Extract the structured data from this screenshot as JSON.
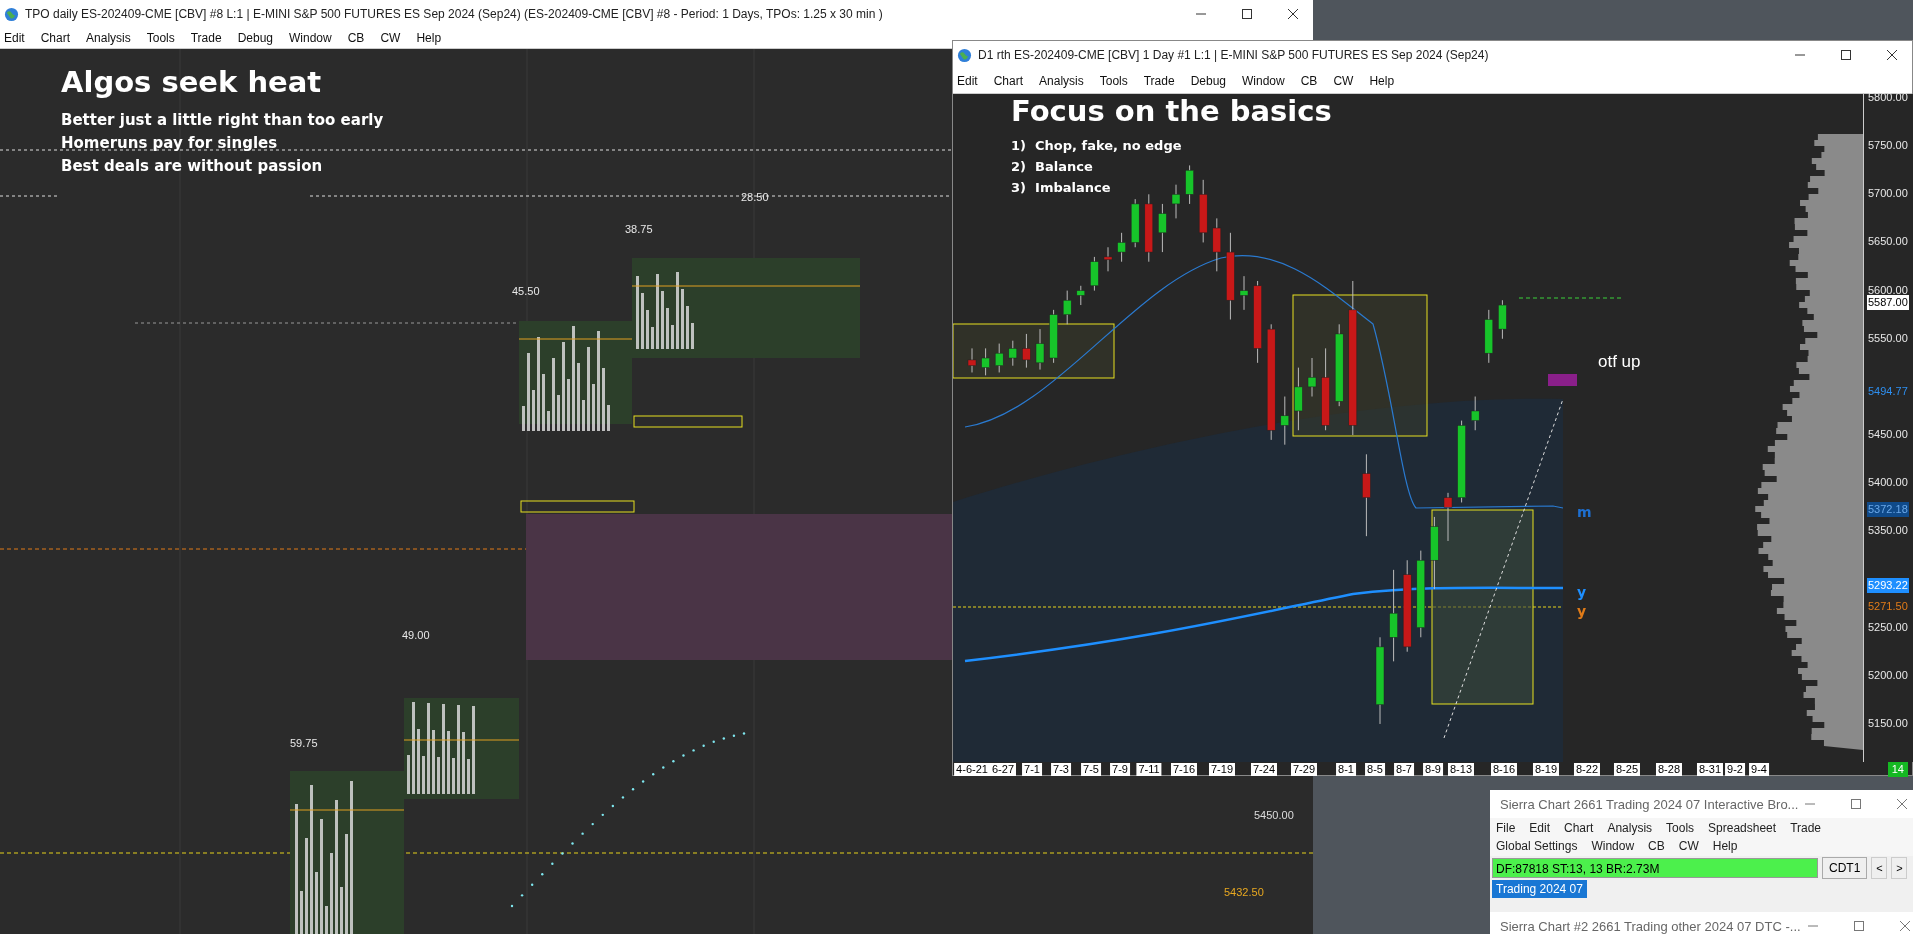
{
  "tpo_window": {
    "title": "TPO daily ES-202409-CME [CBV] #8 L:1 | E-MINI S&P 500 FUTURES ES Sep 2024 (Sep24) (ES-202409-CME [CBV] #8 - Period: 1 Days, TPOs: 1.25 x 30 min  )",
    "menu": [
      "Edit",
      "Chart",
      "Analysis",
      "Tools",
      "Trade",
      "Debug",
      "Window",
      "CB",
      "CW",
      "Help"
    ],
    "headline": "Algos seek heat",
    "notes": [
      "Better just a little right than too early",
      "Homeruns pay for singles",
      "Best deals are without passion"
    ],
    "profile_labels": [
      "59.75",
      "49.00",
      "45.50",
      "38.75",
      "28.50"
    ],
    "price_labels": [
      {
        "text": "5450.00",
        "kind": "tick"
      },
      {
        "text": "5432.50",
        "kind": "level"
      }
    ]
  },
  "chart_window": {
    "title": "D1 rth ES-202409-CME [CBV]  1 Day  #1 L:1 | E-MINI S&P 500 FUTURES ES Sep 2024 (Sep24)",
    "menu": [
      "Edit",
      "Chart",
      "Analysis",
      "Tools",
      "Trade",
      "Debug",
      "Window",
      "CB",
      "CW",
      "Help"
    ],
    "headline": "Focus on the basics",
    "points": [
      "1)  Chop, fake, no edge",
      "2)  Balance",
      "3)  Imbalance"
    ],
    "annotation": "otf up",
    "line_markers": [
      {
        "text": "m",
        "color": "#1e6fd0"
      },
      {
        "text": "y",
        "color": "#1e8fff"
      },
      {
        "text": "y",
        "color": "#e07b18"
      }
    ],
    "price_axis": [
      {
        "text": "5800.00",
        "kind": "tick"
      },
      {
        "text": "5750.00",
        "kind": "tick"
      },
      {
        "text": "5700.00",
        "kind": "tick"
      },
      {
        "text": "5650.00",
        "kind": "tick"
      },
      {
        "text": "5600.00",
        "kind": "tick"
      },
      {
        "text": "5587.00",
        "kind": "last"
      },
      {
        "text": "5550.00",
        "kind": "tick"
      },
      {
        "text": "5494.77",
        "kind": "line"
      },
      {
        "text": "5450.00",
        "kind": "tick"
      },
      {
        "text": "5400.00",
        "kind": "tick"
      },
      {
        "text": "5372.18",
        "kind": "band"
      },
      {
        "text": "5350.00",
        "kind": "tick"
      },
      {
        "text": "5293.22",
        "kind": "average"
      },
      {
        "text": "5271.50",
        "kind": "level"
      },
      {
        "text": "5250.00",
        "kind": "tick"
      },
      {
        "text": "5200.00",
        "kind": "tick"
      },
      {
        "text": "5150.00",
        "kind": "tick"
      }
    ],
    "date_axis": [
      "4-6-21",
      "6-27",
      "7-1",
      "7-3",
      "7-5",
      "7-9",
      "7-11",
      "7-16",
      "7-19",
      "7-24",
      "7-29",
      "8-1",
      "8-5",
      "8-7",
      "8-9",
      "8-13",
      "8-16",
      "8-19",
      "8-22",
      "8-25",
      "8-28",
      "8-31",
      "9-2",
      "9-4"
    ],
    "corner_badge": "14"
  },
  "trading_window": {
    "title": "Sierra Chart 2661 Trading 2024 07 Interactive Bro...",
    "menu": [
      "File",
      "Edit",
      "Chart",
      "Analysis",
      "Tools",
      "Spreadsheet",
      "Trade",
      "Global Settings",
      "Window",
      "CB",
      "CW",
      "Help"
    ],
    "status": "DF:87818  ST:13, 13  BR:2.73M",
    "button": "CDT1",
    "nav": [
      "<",
      ">"
    ],
    "tabs": [
      {
        "label": "Trading 2024 07",
        "selected": true
      }
    ]
  },
  "second_window": {
    "title": "Sierra Chart #2 2661 Trading other 2024 07 DTC -..."
  }
}
